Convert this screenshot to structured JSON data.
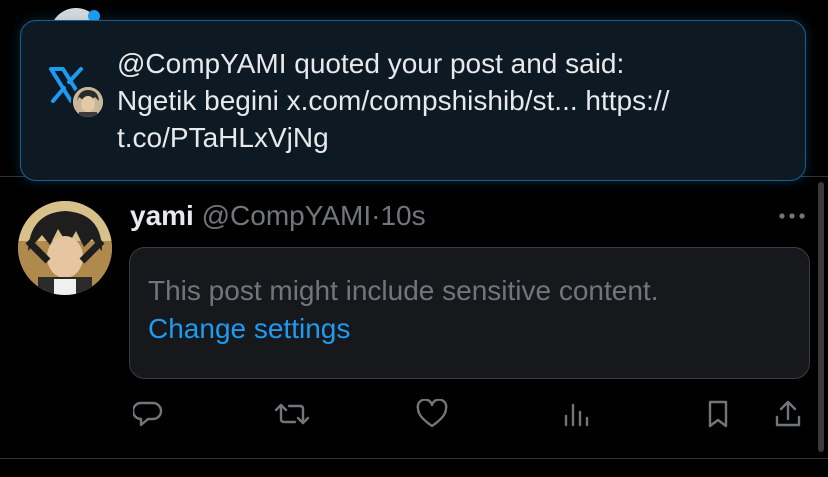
{
  "notification": {
    "line1": "@CompYAMI quoted your post and said:",
    "line2": "Ngetik begini x.com/compshishib/st... https://",
    "line3": "t.co/PTaHLxVjNg",
    "app_icon": "x-logo-icon",
    "accent_color": "#1d9bf0"
  },
  "post": {
    "name": "yami",
    "handle": "@CompYAMI",
    "separator": "·",
    "time": "10s",
    "sensitive_warning": "This post might include sensitive content.",
    "change_settings": "Change settings",
    "actions": [
      "reply-icon",
      "repost-icon",
      "like-icon",
      "views-icon",
      "bookmark-icon",
      "share-icon"
    ]
  },
  "colors": {
    "background": "#000000",
    "link": "#1d9bf0",
    "muted": "#71767b",
    "text": "#e7e9ea"
  }
}
